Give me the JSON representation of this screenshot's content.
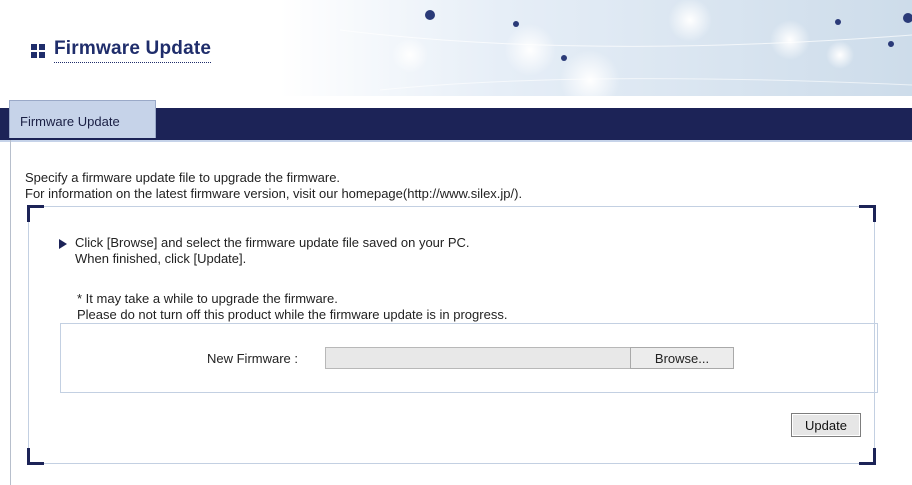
{
  "header": {
    "title": "Firmware Update"
  },
  "tabs": [
    {
      "label": "Firmware Update"
    }
  ],
  "intro": {
    "line1": "Specify a firmware update file to upgrade the firmware.",
    "line2": "For information on the latest firmware version, visit our homepage(http://www.silex.jp/)."
  },
  "instructions": {
    "line1": "Click [Browse] and select the firmware update file saved on your PC.",
    "line2": "When finished, click [Update]."
  },
  "note": {
    "line1": "* It may take a while to upgrade the firmware.",
    "line2": "Please do not turn off this product while the firmware update is in progress."
  },
  "form": {
    "new_firmware_label": "New Firmware :",
    "file_value": "",
    "browse_label": "Browse...",
    "update_label": "Update"
  },
  "colors": {
    "navy": "#1c2357",
    "tab": "#c6d3e9",
    "title": "#1f2d6b"
  }
}
